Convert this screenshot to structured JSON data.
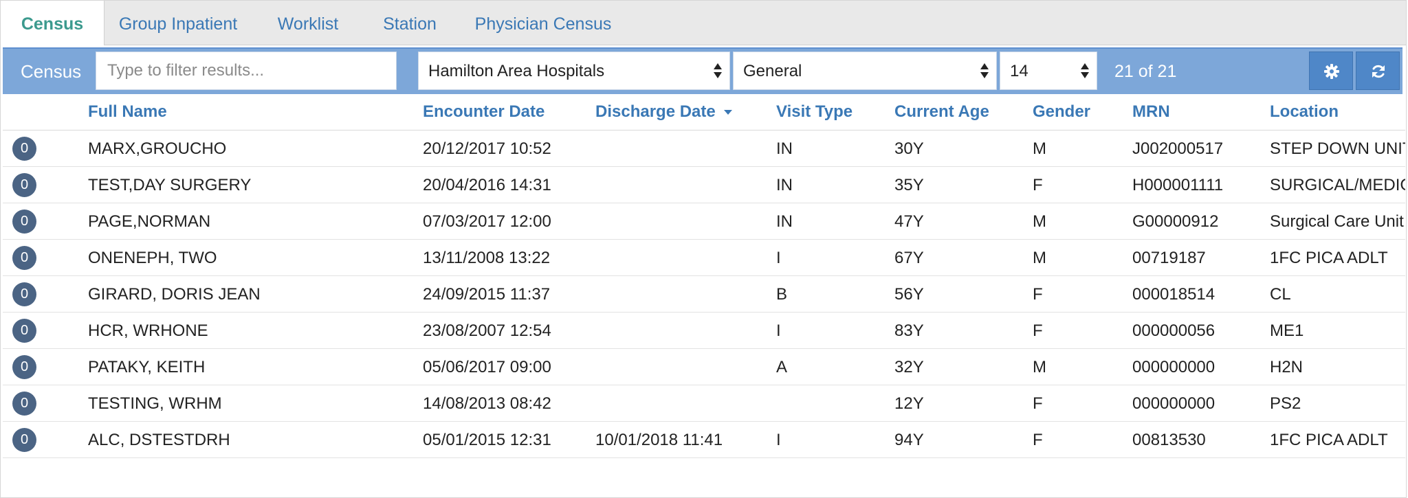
{
  "tabs": [
    {
      "label": "Census",
      "active": true
    },
    {
      "label": "Group Inpatient",
      "active": false
    },
    {
      "label": "Worklist",
      "active": false
    },
    {
      "label": "Station",
      "active": false
    },
    {
      "label": "Physician Census",
      "active": false
    }
  ],
  "toolbar": {
    "title": "Census",
    "filter_placeholder": "Type to filter results...",
    "hospital_select": "Hamilton Area Hospitals",
    "category_select": "General",
    "days_select": "14",
    "result_count": "21 of 21",
    "settings_icon": "gear-icon",
    "refresh_icon": "refresh-icon"
  },
  "table": {
    "columns": [
      "Full Name",
      "Encounter Date",
      "Discharge Date",
      "Visit Type",
      "Current Age",
      "Gender",
      "MRN",
      "Location"
    ],
    "rows": [
      {
        "badge": "0",
        "name": "MARX,GROUCHO",
        "encounter": "20/12/2017 10:52",
        "discharge": "",
        "visit": "IN",
        "age": "30Y",
        "gender": "M",
        "mrn": "J002000517",
        "location": "STEP DOWN UNIT"
      },
      {
        "badge": "0",
        "name": "TEST,DAY SURGERY",
        "encounter": "20/04/2016 14:31",
        "discharge": "",
        "visit": "IN",
        "age": "35Y",
        "gender": "F",
        "mrn": "H000001111",
        "location": "SURGICAL/MEDIC"
      },
      {
        "badge": "0",
        "name": "PAGE,NORMAN",
        "encounter": "07/03/2017 12:00",
        "discharge": "",
        "visit": "IN",
        "age": "47Y",
        "gender": "M",
        "mrn": "G00000912",
        "location": "Surgical Care Unit"
      },
      {
        "badge": "0",
        "name": "ONENEPH, TWO",
        "encounter": "13/11/2008 13:22",
        "discharge": "",
        "visit": "I",
        "age": "67Y",
        "gender": "M",
        "mrn": "00719187",
        "location": "1FC PICA ADLT"
      },
      {
        "badge": "0",
        "name": "GIRARD, DORIS JEAN",
        "encounter": "24/09/2015 11:37",
        "discharge": "",
        "visit": "B",
        "age": "56Y",
        "gender": "F",
        "mrn": "000018514",
        "location": "CL"
      },
      {
        "badge": "0",
        "name": "HCR, WRHONE",
        "encounter": "23/08/2007 12:54",
        "discharge": "",
        "visit": "I",
        "age": "83Y",
        "gender": "F",
        "mrn": "000000056",
        "location": "ME1"
      },
      {
        "badge": "0",
        "name": "PATAKY, KEITH",
        "encounter": "05/06/2017 09:00",
        "discharge": "",
        "visit": "A",
        "age": "32Y",
        "gender": "M",
        "mrn": "000000000",
        "location": "H2N"
      },
      {
        "badge": "0",
        "name": "TESTING, WRHM",
        "encounter": "14/08/2013 08:42",
        "discharge": "",
        "visit": "",
        "age": "12Y",
        "gender": "F",
        "mrn": "000000000",
        "location": "PS2"
      },
      {
        "badge": "0",
        "name": "ALC, DSTESTDRH",
        "encounter": "05/01/2015 12:31",
        "discharge": "10/01/2018 11:41",
        "visit": "I",
        "age": "94Y",
        "gender": "F",
        "mrn": "00813530",
        "location": "1FC PICA ADLT"
      }
    ]
  },
  "colors": {
    "accent_tab": "#3c9a8e",
    "link_blue": "#3a78b5",
    "toolbar_bg": "#7da7d9",
    "button_bg": "#4f87c8",
    "badge_bg": "#4b6484"
  }
}
